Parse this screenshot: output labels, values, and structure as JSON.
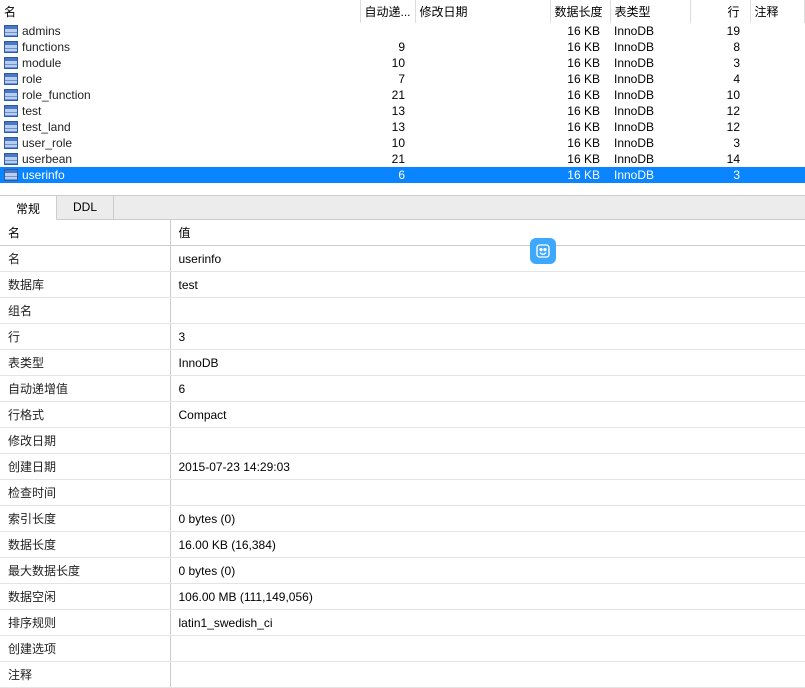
{
  "table_list": {
    "headers": {
      "name": "名",
      "auto_inc": "自动递...",
      "modify_date": "修改日期",
      "data_len": "数据长度",
      "table_type": "表类型",
      "rows": "行",
      "comment": "注释"
    },
    "rows": [
      {
        "name": "admins",
        "auto_inc": "",
        "modify_date": "",
        "data_len": "16 KB",
        "table_type": "InnoDB",
        "rows": "19",
        "comment": "",
        "selected": false
      },
      {
        "name": "functions",
        "auto_inc": "9",
        "modify_date": "",
        "data_len": "16 KB",
        "table_type": "InnoDB",
        "rows": "8",
        "comment": "",
        "selected": false
      },
      {
        "name": "module",
        "auto_inc": "10",
        "modify_date": "",
        "data_len": "16 KB",
        "table_type": "InnoDB",
        "rows": "3",
        "comment": "",
        "selected": false
      },
      {
        "name": "role",
        "auto_inc": "7",
        "modify_date": "",
        "data_len": "16 KB",
        "table_type": "InnoDB",
        "rows": "4",
        "comment": "",
        "selected": false
      },
      {
        "name": "role_function",
        "auto_inc": "21",
        "modify_date": "",
        "data_len": "16 KB",
        "table_type": "InnoDB",
        "rows": "10",
        "comment": "",
        "selected": false
      },
      {
        "name": "test",
        "auto_inc": "13",
        "modify_date": "",
        "data_len": "16 KB",
        "table_type": "InnoDB",
        "rows": "12",
        "comment": "",
        "selected": false
      },
      {
        "name": "test_land",
        "auto_inc": "13",
        "modify_date": "",
        "data_len": "16 KB",
        "table_type": "InnoDB",
        "rows": "12",
        "comment": "",
        "selected": false
      },
      {
        "name": "user_role",
        "auto_inc": "10",
        "modify_date": "",
        "data_len": "16 KB",
        "table_type": "InnoDB",
        "rows": "3",
        "comment": "",
        "selected": false
      },
      {
        "name": "userbean",
        "auto_inc": "21",
        "modify_date": "",
        "data_len": "16 KB",
        "table_type": "InnoDB",
        "rows": "14",
        "comment": "",
        "selected": false
      },
      {
        "name": "userinfo",
        "auto_inc": "6",
        "modify_date": "",
        "data_len": "16 KB",
        "table_type": "InnoDB",
        "rows": "3",
        "comment": "",
        "selected": true
      }
    ]
  },
  "tabs": {
    "general": "常规",
    "ddl": "DDL"
  },
  "prop_panel": {
    "header_key": "名",
    "header_value": "值",
    "rows": [
      {
        "key": "名",
        "value": "userinfo"
      },
      {
        "key": "数据库",
        "value": "test"
      },
      {
        "key": "组名",
        "value": ""
      },
      {
        "key": "行",
        "value": "3"
      },
      {
        "key": "表类型",
        "value": "InnoDB"
      },
      {
        "key": "自动递增值",
        "value": "6"
      },
      {
        "key": "行格式",
        "value": "Compact"
      },
      {
        "key": "修改日期",
        "value": ""
      },
      {
        "key": "创建日期",
        "value": "2015-07-23 14:29:03"
      },
      {
        "key": "检查时间",
        "value": ""
      },
      {
        "key": "索引长度",
        "value": "0 bytes (0)"
      },
      {
        "key": "数据长度",
        "value": "16.00 KB (16,384)"
      },
      {
        "key": "最大数据长度",
        "value": "0 bytes (0)"
      },
      {
        "key": "数据空闲",
        "value": "106.00 MB (111,149,056)"
      },
      {
        "key": "排序规则",
        "value": "latin1_swedish_ci"
      },
      {
        "key": "创建选项",
        "value": ""
      },
      {
        "key": "注释",
        "value": ""
      }
    ]
  }
}
